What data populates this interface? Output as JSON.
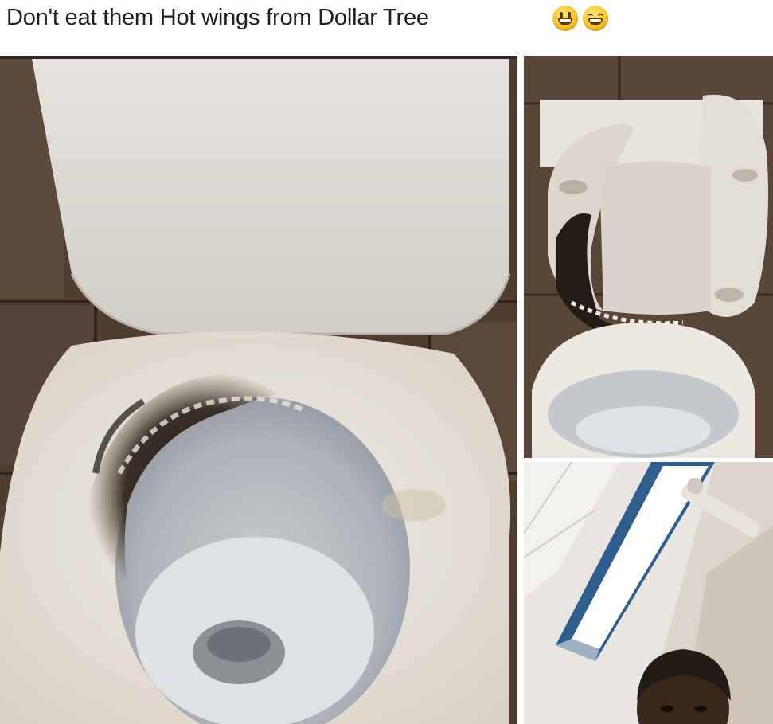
{
  "post": {
    "caption": "Don't eat them Hot wings from Dollar Tree",
    "emojis": [
      "smiling-face-icon",
      "grinning-face-icon"
    ]
  },
  "photos": [
    {
      "name": "burnt-toilet-bowl-photo"
    },
    {
      "name": "melted-toilet-seat-photo"
    },
    {
      "name": "bathroom-selfie-photo"
    }
  ],
  "colors": {
    "caption_text": "#1c1e21",
    "porcelain": "#ece8e2",
    "scorch": "#2b241e",
    "floor_tile": "#5a4636"
  }
}
